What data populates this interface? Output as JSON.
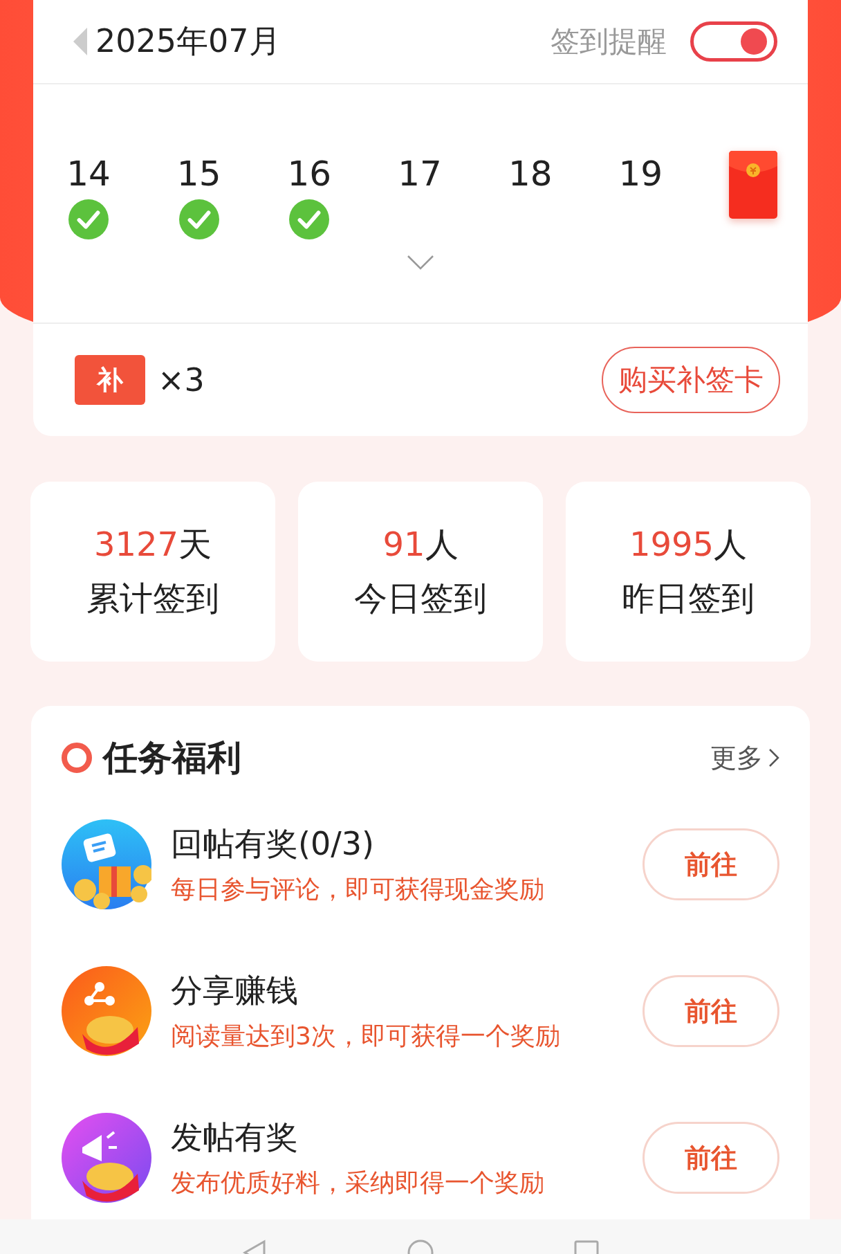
{
  "header": {
    "month": "2025年07月",
    "reminder_label": "签到提醒",
    "reminder_on": true
  },
  "calendar": {
    "days": [
      {
        "day": "14",
        "checked": true
      },
      {
        "day": "15",
        "checked": true
      },
      {
        "day": "16",
        "checked": true
      },
      {
        "day": "17",
        "checked": false
      },
      {
        "day": "18",
        "checked": false
      },
      {
        "day": "19",
        "checked": false
      }
    ]
  },
  "makeup": {
    "card_label": "补",
    "count": "×3",
    "buy_button": "购买补签卡"
  },
  "stats": [
    {
      "value": "3127",
      "unit": "天",
      "label": "累计签到"
    },
    {
      "value": "91",
      "unit": "人",
      "label": "今日签到"
    },
    {
      "value": "1995",
      "unit": "人",
      "label": "昨日签到"
    }
  ],
  "tasks": {
    "title": "任务福利",
    "more": "更多",
    "items": [
      {
        "kind": "comment",
        "name": "回帖有奖(0/3)",
        "desc": "每日参与评论，即可获得现金奖励",
        "button": "前往"
      },
      {
        "kind": "share",
        "name": "分享赚钱",
        "desc": "阅读量达到3次，即可获得一个奖励",
        "button": "前往"
      },
      {
        "kind": "post",
        "name": "发帖有奖",
        "desc": "发布优质好料，采纳即得一个奖励",
        "button": "前往"
      }
    ]
  }
}
